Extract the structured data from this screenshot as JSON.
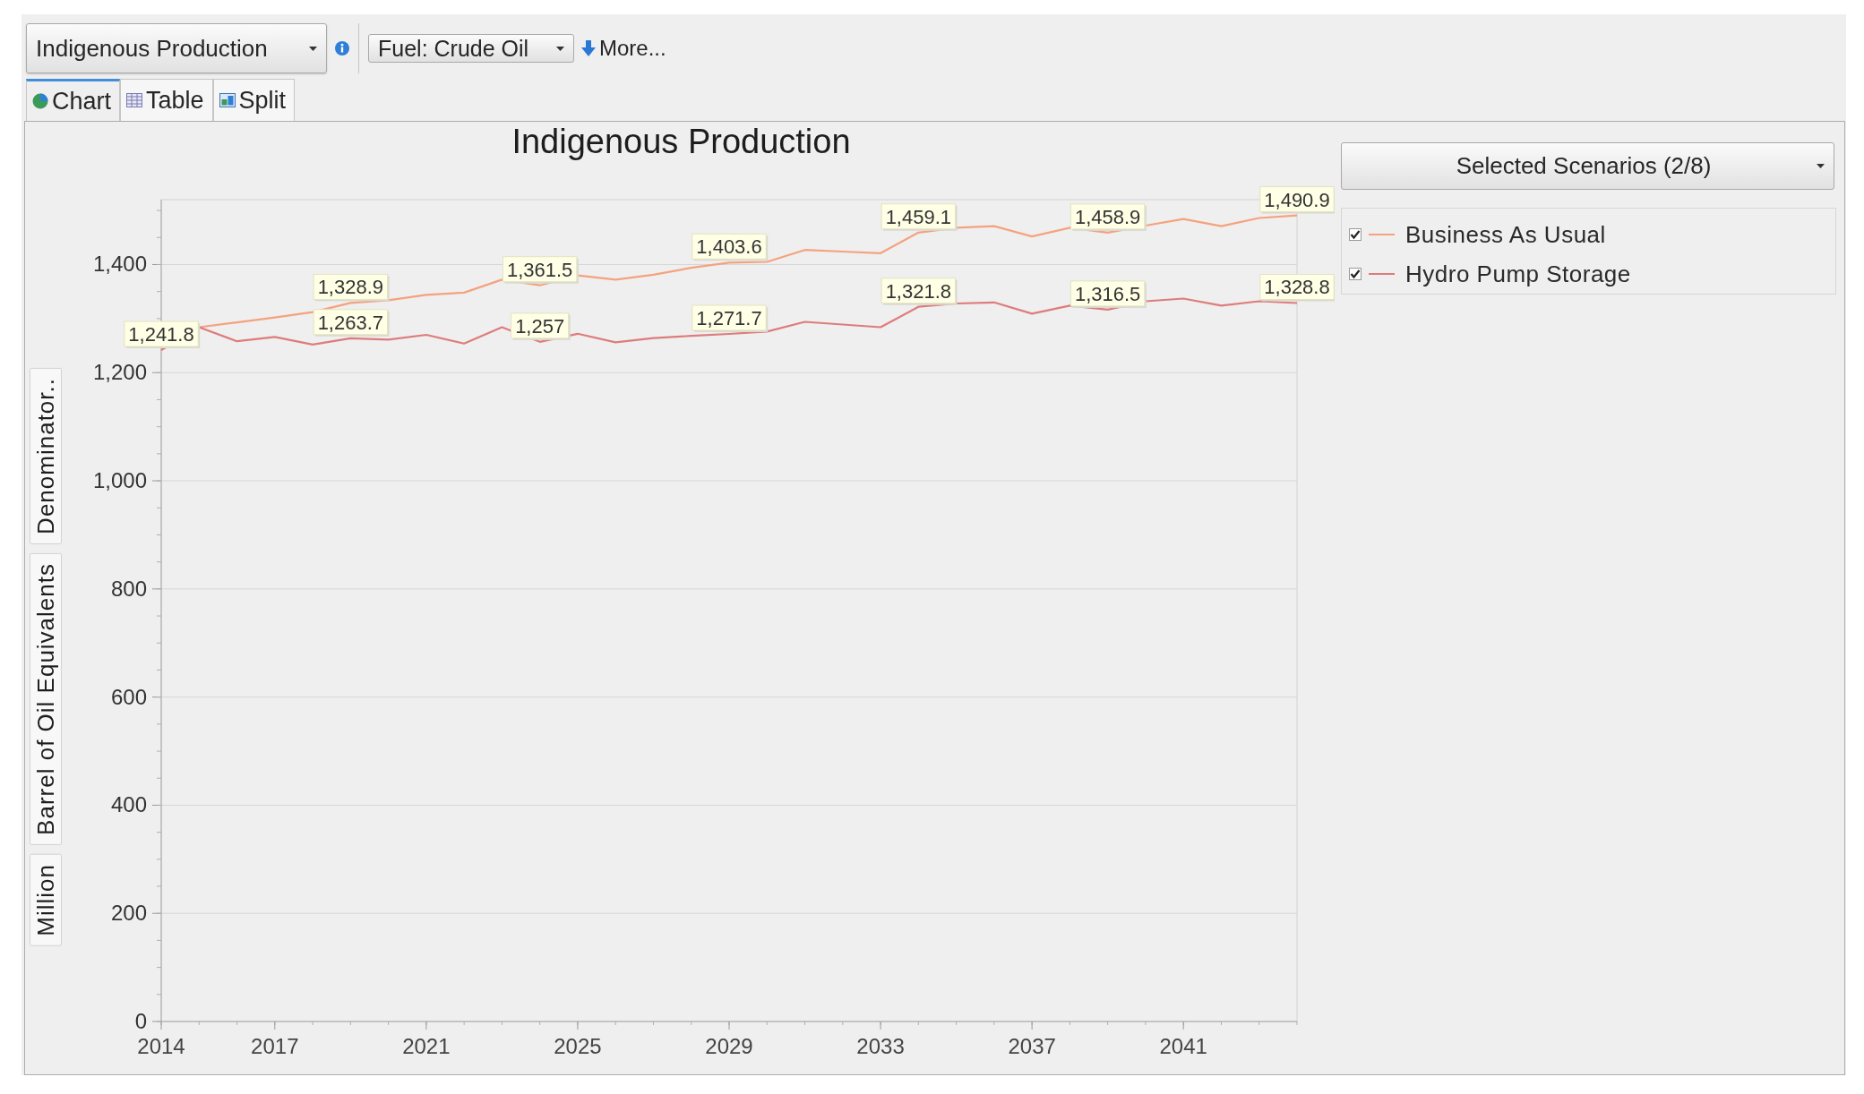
{
  "toolbar": {
    "indicator_dropdown": {
      "label": "Indigenous Production"
    },
    "filter_dropdown": {
      "label": "Fuel: Crude Oil"
    },
    "more_link": {
      "label": "More..."
    }
  },
  "view_tabs": [
    {
      "label": "Chart",
      "kind": "chart",
      "selected": true
    },
    {
      "label": "Table",
      "kind": "table",
      "selected": false
    },
    {
      "label": "Split",
      "kind": "split",
      "selected": false
    }
  ],
  "chart": {
    "unit_buttons": [
      "Million",
      "Barrel of Oil Equivalents",
      "Denominator.."
    ],
    "scenario_dropdown": {
      "label": "Selected Scenarios (2/8)"
    },
    "legend": [
      {
        "checked": true
      },
      {
        "checked": true
      }
    ],
    "chart_data": {
      "type": "line",
      "title": "Indigenous Production",
      "x": [
        2014,
        2015,
        2016,
        2017,
        2018,
        2019,
        2020,
        2021,
        2022,
        2023,
        2024,
        2025,
        2026,
        2027,
        2028,
        2029,
        2030,
        2031,
        2032,
        2033,
        2034,
        2035,
        2036,
        2037,
        2038,
        2039,
        2040,
        2041,
        2042,
        2043,
        2044
      ],
      "series": [
        {
          "name": "Business As Usual",
          "color": "#f5a27e",
          "values": [
            1241.8,
            1284,
            1293,
            1302,
            1312,
            1328.9,
            1334,
            1344,
            1348,
            1372,
            1361.5,
            1380,
            1372,
            1381,
            1394,
            1403.6,
            1405,
            1427,
            1424,
            1421,
            1459.1,
            1468,
            1471,
            1452,
            1468,
            1458.9,
            1472,
            1484,
            1471,
            1486,
            1490.9
          ]
        },
        {
          "name": "Hydro Pump Storage",
          "color": "#de7c7c",
          "values": [
            1241.8,
            1284,
            1258,
            1266,
            1252,
            1263.7,
            1261,
            1270,
            1254,
            1284,
            1257,
            1272,
            1256,
            1264,
            1268,
            1271.7,
            1276,
            1294,
            1289,
            1284,
            1321.8,
            1328,
            1330,
            1309,
            1324,
            1316.5,
            1332,
            1337,
            1324,
            1332,
            1328.8
          ]
        }
      ],
      "xlim": [
        2014,
        2044
      ],
      "ylim": [
        0,
        1520
      ],
      "grid": true,
      "xticks": [
        2014,
        2017,
        2021,
        2025,
        2029,
        2033,
        2037,
        2041
      ],
      "yticks": [
        {
          "value": 0,
          "label": "0"
        },
        {
          "value": 200,
          "label": "200"
        },
        {
          "value": 400,
          "label": "400"
        },
        {
          "value": 600,
          "label": "600"
        },
        {
          "value": 800,
          "label": "800"
        },
        {
          "value": 1000,
          "label": "1,000"
        },
        {
          "value": 1200,
          "label": "1,200"
        },
        {
          "value": 1400,
          "label": "1,400"
        }
      ],
      "annotations": [
        {
          "x": 2014,
          "y": 1241.8,
          "text": "1,241.8"
        },
        {
          "x": 2019,
          "y": 1328.9,
          "text": "1,328.9"
        },
        {
          "x": 2019,
          "y": 1263.7,
          "text": "1,263.7"
        },
        {
          "x": 2024,
          "y": 1361.5,
          "text": "1,361.5"
        },
        {
          "x": 2024,
          "y": 1257,
          "text": "1,257"
        },
        {
          "x": 2029,
          "y": 1403.6,
          "text": "1,403.6"
        },
        {
          "x": 2029,
          "y": 1271.7,
          "text": "1,271.7"
        },
        {
          "x": 2034,
          "y": 1459.1,
          "text": "1,459.1"
        },
        {
          "x": 2034,
          "y": 1321.8,
          "text": "1,321.8"
        },
        {
          "x": 2039,
          "y": 1458.9,
          "text": "1,458.9"
        },
        {
          "x": 2039,
          "y": 1316.5,
          "text": "1,316.5"
        },
        {
          "x": 2044,
          "y": 1490.9,
          "text": "1,490.9"
        },
        {
          "x": 2044,
          "y": 1328.8,
          "text": "1,328.8"
        }
      ]
    }
  }
}
